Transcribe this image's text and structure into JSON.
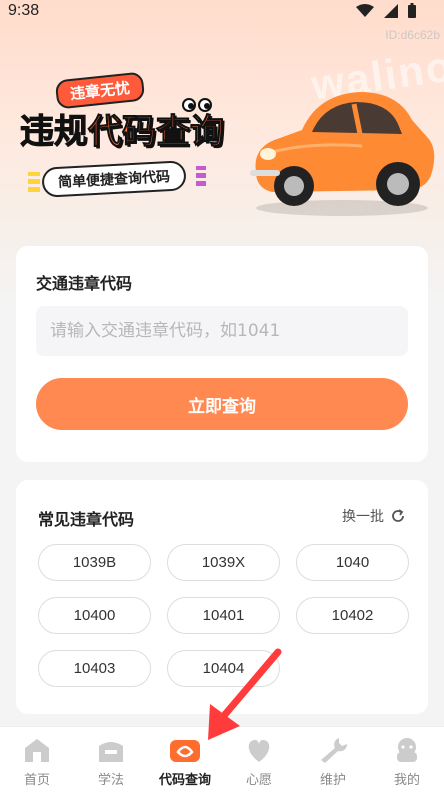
{
  "status_bar": {
    "time": "9:38",
    "id_tag": "ID:d6c62b"
  },
  "hero": {
    "watermark": "walino",
    "badge": "违章无忧",
    "title_part1": "违规",
    "title_part2": "代码查询",
    "subtitle": "简单便捷查询代码"
  },
  "search_card": {
    "title": "交通违章代码",
    "input_placeholder": "请输入交通违章代码，如1041",
    "input_value": "",
    "query_button": "立即查询"
  },
  "common_codes": {
    "title": "常见违章代码",
    "refresh_label": "换一批",
    "codes": [
      "1039B",
      "1039X",
      "1040",
      "10400",
      "10401",
      "10402",
      "10403",
      "10404"
    ]
  },
  "tabbar": {
    "tabs": [
      {
        "label": "首页",
        "icon": "home-icon",
        "active": false
      },
      {
        "label": "学法",
        "icon": "book-icon",
        "active": false
      },
      {
        "label": "代码查询",
        "icon": "code-query-icon",
        "active": true
      },
      {
        "label": "心愿",
        "icon": "heart-icon",
        "active": false
      },
      {
        "label": "维护",
        "icon": "wrench-icon",
        "active": false
      },
      {
        "label": "我的",
        "icon": "profile-icon",
        "active": false
      }
    ]
  },
  "colors": {
    "accent": "#ff8950",
    "brand_red": "#ff5a3a",
    "active_tab": "#ff6d2e"
  }
}
